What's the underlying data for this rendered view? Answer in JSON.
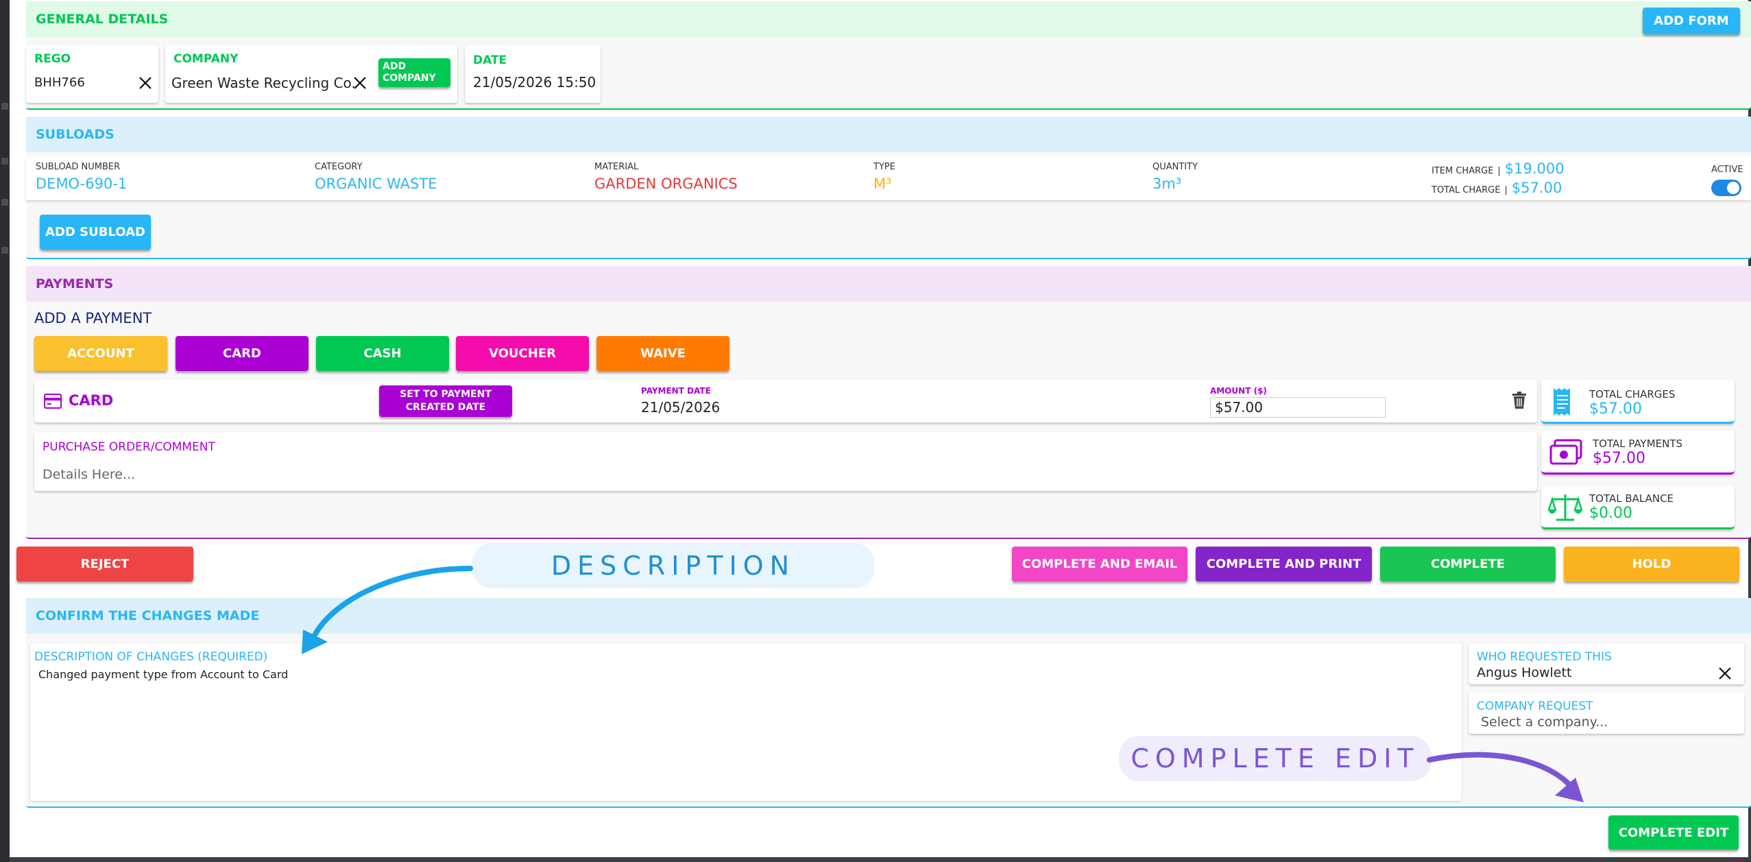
{
  "colors": {
    "green": "#00c853",
    "teal": "#29b6f6",
    "purple": "#9c27b0",
    "red": "#e53935",
    "orange": "#ff9800"
  },
  "general": {
    "title": "GENERAL DETAILS",
    "add_form": "ADD FORM",
    "rego_label": "REGO",
    "rego_value": "BHH766",
    "company_label": "COMPANY",
    "company_value": "Green Waste Recycling Co.",
    "add_company": "ADD COMPANY",
    "date_label": "DATE",
    "date_value": "21/05/2026 15:50"
  },
  "subloads": {
    "title": "SUBLOADS",
    "headers": {
      "number": "SUBLOAD NUMBER",
      "category": "CATEGORY",
      "material": "MATERIAL",
      "type": "TYPE",
      "quantity": "QUANTITY",
      "item_charge": "ITEM CHARGE",
      "total_charge": "TOTAL CHARGE",
      "active": "ACTIVE"
    },
    "row": {
      "number": "DEMO-690-1",
      "category": "ORGANIC WASTE",
      "material": "GARDEN ORGANICS",
      "type": "M³",
      "quantity": "3m³",
      "item_charge": "$19.000",
      "total_charge": "$57.00",
      "sep": "|",
      "active": true
    },
    "add_subload": "ADD SUBLOAD"
  },
  "payments": {
    "title": "PAYMENTS",
    "add_payment": "ADD A PAYMENT",
    "buttons": [
      "ACCOUNT",
      "CARD",
      "CASH",
      "VOUCHER",
      "WAIVE"
    ],
    "line": {
      "method": "CARD",
      "set_date_btn": "SET TO PAYMENT CREATED DATE",
      "date_label": "PAYMENT DATE",
      "date_value": "21/05/2026",
      "amount_label": "AMOUNT ($)",
      "amount_value": "$57.00"
    },
    "po_label": "PURCHASE ORDER/COMMENT",
    "po_placeholder": "Details Here...",
    "totals": {
      "charges_label": "TOTAL CHARGES",
      "charges_value": "$57.00",
      "payments_label": "TOTAL PAYMENTS",
      "payments_value": "$57.00",
      "balance_label": "TOTAL BALANCE",
      "balance_value": "$0.00"
    }
  },
  "actions": {
    "reject": "REJECT",
    "complete_email": "COMPLETE AND EMAIL",
    "complete_print": "COMPLETE AND PRINT",
    "complete": "COMPLETE",
    "hold": "HOLD"
  },
  "confirm": {
    "title": "CONFIRM THE CHANGES MADE",
    "desc_label": "DESCRIPTION OF CHANGES (REQUIRED)",
    "desc_value": "Changed payment type from Account to Card",
    "who_label": "WHO REQUESTED THIS",
    "who_value": "Angus Howlett",
    "company_label": "COMPANY REQUEST",
    "company_placeholder": "Select a company...",
    "complete_edit": "COMPLETE EDIT"
  },
  "annotations": {
    "description": "DESCRIPTION",
    "complete_edit": "COMPLETE EDIT"
  },
  "icons": [
    "close-icon",
    "credit-card-icon",
    "trash-icon",
    "receipt-icon",
    "cash-icon",
    "scale-icon",
    "toggle-switch"
  ]
}
